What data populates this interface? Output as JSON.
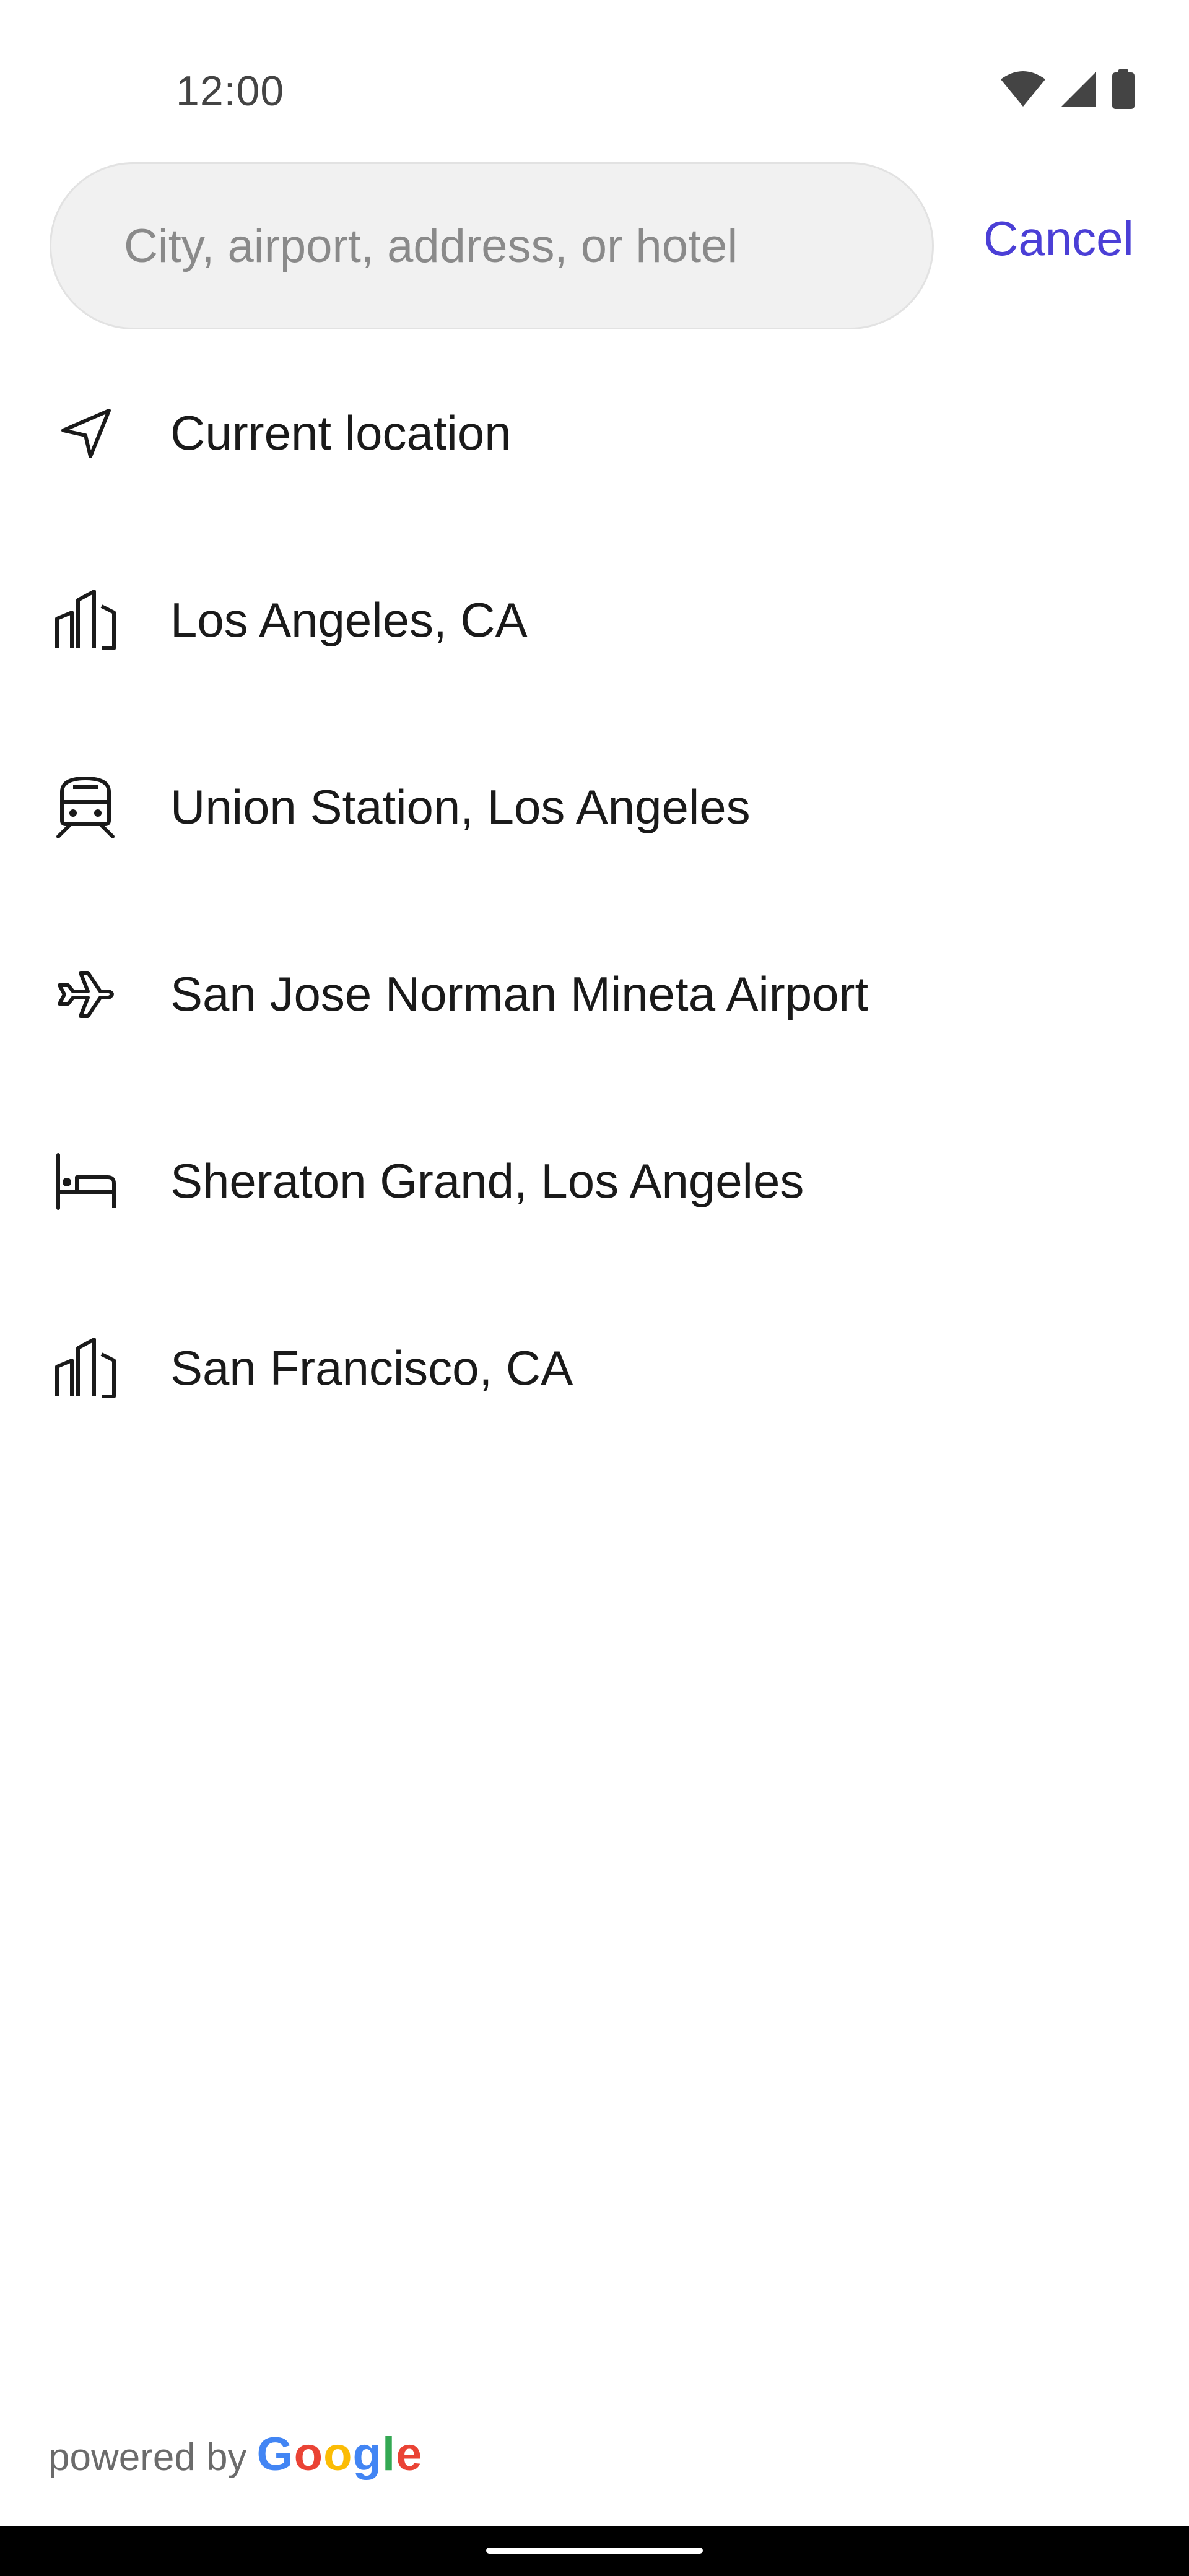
{
  "status_bar": {
    "time": "12:00",
    "icons": [
      "wifi-icon",
      "cell-signal-icon",
      "battery-icon"
    ]
  },
  "search": {
    "placeholder": "City, airport, address, or hotel",
    "value": "",
    "cancel_label": "Cancel"
  },
  "results": [
    {
      "icon": "navigation-arrow-icon",
      "label": "Current location"
    },
    {
      "icon": "city-buildings-icon",
      "label": "Los Angeles, CA"
    },
    {
      "icon": "train-icon",
      "label": "Union Station, Los Angeles"
    },
    {
      "icon": "airplane-icon",
      "label": "San Jose Norman Mineta Airport"
    },
    {
      "icon": "hotel-bed-icon",
      "label": "Sheraton Grand, Los Angeles"
    },
    {
      "icon": "city-buildings-icon",
      "label": "San Francisco, CA"
    }
  ],
  "footer": {
    "powered_by": "powered by",
    "google_letters": [
      "G",
      "o",
      "o",
      "g",
      "l",
      "e"
    ],
    "google_colors": [
      "#4285F4",
      "#EA4335",
      "#FBBC05",
      "#4285F4",
      "#34A853",
      "#EA4335"
    ]
  },
  "colors": {
    "accent": "#4b3fd6",
    "search_bg": "#f1f1f1",
    "text": "#1a1a1a",
    "placeholder": "#8a8a8a"
  }
}
